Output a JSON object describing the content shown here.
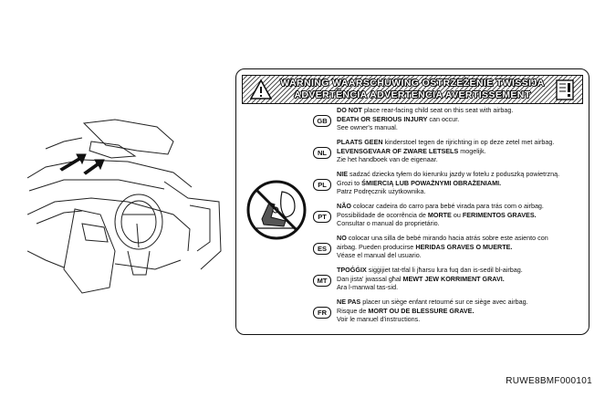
{
  "label": {
    "header_line1": "WARNING WAARSCHUWING OSTRZEŻENIE TWISSIJA",
    "header_line2": "ADVERTÊNCIA ADVERTENCIA AVERTISSEMENT",
    "warning_icon": "warning-triangle-icon",
    "manual_icon": "owners-manual-icon",
    "pictogram": "no-rear-facing-child-seat-icon",
    "entries": [
      {
        "lang": "GB",
        "l1_b": "DO NOT",
        "l1": " place rear-facing child seat on this seat with airbag.",
        "l2_b": "DEATH OR SERIOUS INJURY",
        "l2": " can occur.",
        "l3": "See owner's manual."
      },
      {
        "lang": "NL",
        "l1_b": "PLAATS GEEN",
        "l1": " kinderstoel tegen de rijrichting in op deze zetel met airbag.",
        "l2_b": "LEVENSGEVAAR OF ZWARE LETSELS",
        "l2": " mogelijk.",
        "l3": "Zie het handboek van de eigenaar."
      },
      {
        "lang": "PL",
        "l1_b": "NIE",
        "l1": " sadzać dziecka tyłem do kierunku jazdy w fotelu z poduszką powietrzną.",
        "l2_b": "ŚMIERCIĄ LUB POWAŻNYMI OBRAŻENIAMI.",
        "l2_pre": "Grozi to ",
        "l3": "Patrz Podręcznik użytkownika."
      },
      {
        "lang": "PT",
        "l1_b": "NÃO",
        "l1": " colocar cadeira do carro para bebé virada para trás com o airbag.",
        "l2_pre": "Possibilidade de ocorrência de ",
        "l2_b": "MORTE",
        "l2_mid": " ou ",
        "l2_b2": "FERIMENTOS GRAVES.",
        "l3": "Consultar o manual do proprietário."
      },
      {
        "lang": "ES",
        "l1_b": "NO",
        "l1": " colocar una silla de bebé mirando hacia atrás sobre este asiento con",
        "l2_pre": "airbag. Pueden producirse ",
        "l2_b": "HERIDAS GRAVES O MUERTE.",
        "l3": "Véase el manual del usuario."
      },
      {
        "lang": "MT",
        "l1_b": "TPOĠĠIX",
        "l1": " siġġijiet tat-tfal li jħarsu lura fuq dan is-sedil bl-airbag.",
        "l2_pre": "Dan jista' jwassal għal ",
        "l2_b": "MEWT JEW KORRIMENT GRAVI.",
        "l3": "Ara l-manwal tas-sid."
      },
      {
        "lang": "FR",
        "l1_b": "NE PAS",
        "l1": " placer un siège enfant retourné sur ce siège avec airbag.",
        "l2_pre": "Risque de ",
        "l2_b": "MORT OU DE BLESSURE GRAVE.",
        "l3": "Voir le manuel d'instructions."
      }
    ]
  },
  "illustration": {
    "name": "vehicle-interior-dashboard",
    "arrow_icon": "arrow-icon"
  },
  "figure_code": "RUWE8BMF000101"
}
